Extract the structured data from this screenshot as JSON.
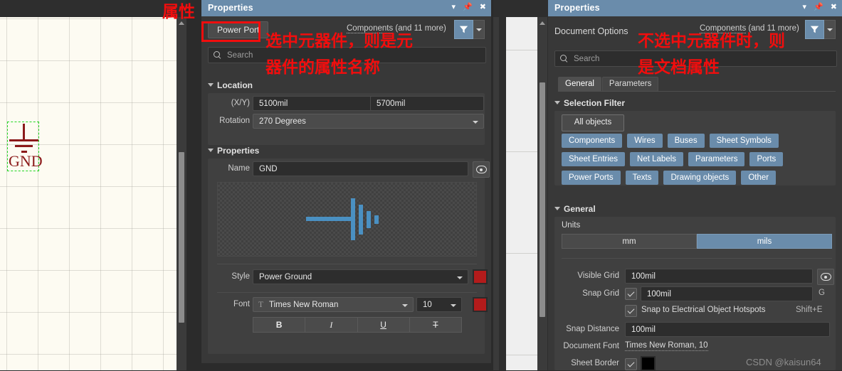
{
  "canvas": {
    "symbol_label": "GND"
  },
  "left_panel": {
    "title": "Properties",
    "title_icons": {
      "collapse": "▾",
      "pin": "pin-icon",
      "close": "close-icon"
    },
    "object_kind": "Power Port",
    "object_count_prefix": "Components",
    "object_count_suffix": " (and 11 more)",
    "search_placeholder": "Search",
    "location": {
      "section": "Location",
      "xy_label": "(X/Y)",
      "x_value": "5100mil",
      "y_value": "5700mil",
      "rotation_label": "Rotation",
      "rotation_value": "270 Degrees"
    },
    "properties": {
      "section": "Properties",
      "name_label": "Name",
      "name_value": "GND",
      "style_label": "Style",
      "style_value": "Power Ground",
      "style_color": "#b31b1b",
      "font_label": "Font",
      "font_value": "Times New Roman",
      "font_size": "10",
      "font_color": "#b31b1b",
      "format_buttons": [
        "B",
        "I",
        "U",
        "T"
      ]
    }
  },
  "right_panel": {
    "title": "Properties",
    "object_kind": "Document Options",
    "object_count_prefix": "Components",
    "object_count_suffix": " (and 11 more)",
    "search_placeholder": "Search",
    "tabs": [
      {
        "label": "General",
        "active": true
      },
      {
        "label": "Parameters",
        "active": false
      }
    ],
    "selection_filter": {
      "section": "Selection Filter",
      "all_objects": "All objects",
      "chips": [
        "Components",
        "Wires",
        "Buses",
        "Sheet Symbols",
        "Sheet Entries",
        "Net Labels",
        "Parameters",
        "Ports",
        "Power Ports",
        "Texts",
        "Drawing objects",
        "Other"
      ]
    },
    "general": {
      "section": "General",
      "units_label": "Units",
      "units": [
        {
          "label": "mm",
          "selected": false
        },
        {
          "label": "mils",
          "selected": true
        }
      ],
      "visible_grid_label": "Visible Grid",
      "visible_grid_value": "100mil",
      "snap_grid_label": "Snap Grid",
      "snap_grid_value": "100mil",
      "snap_grid_key": "G",
      "snap_hotspots_label": "Snap to Electrical Object Hotspots",
      "snap_hotspots_key": "Shift+E",
      "snap_distance_label": "Snap Distance",
      "snap_distance_value": "100mil",
      "document_font_label": "Document Font",
      "document_font_value": "Times New Roman, 10",
      "sheet_border_label": "Sheet Border",
      "sheet_border_color": "#000000"
    }
  },
  "annotations": {
    "canvas_note": "属性",
    "left_note_line1": "选中元器件，则是元",
    "left_note_line2": "器件的属性名称",
    "right_note_line1": "不选中元器件时，则",
    "right_note_line2": "是文档属性"
  },
  "watermark": "CSDN @kaisun64"
}
